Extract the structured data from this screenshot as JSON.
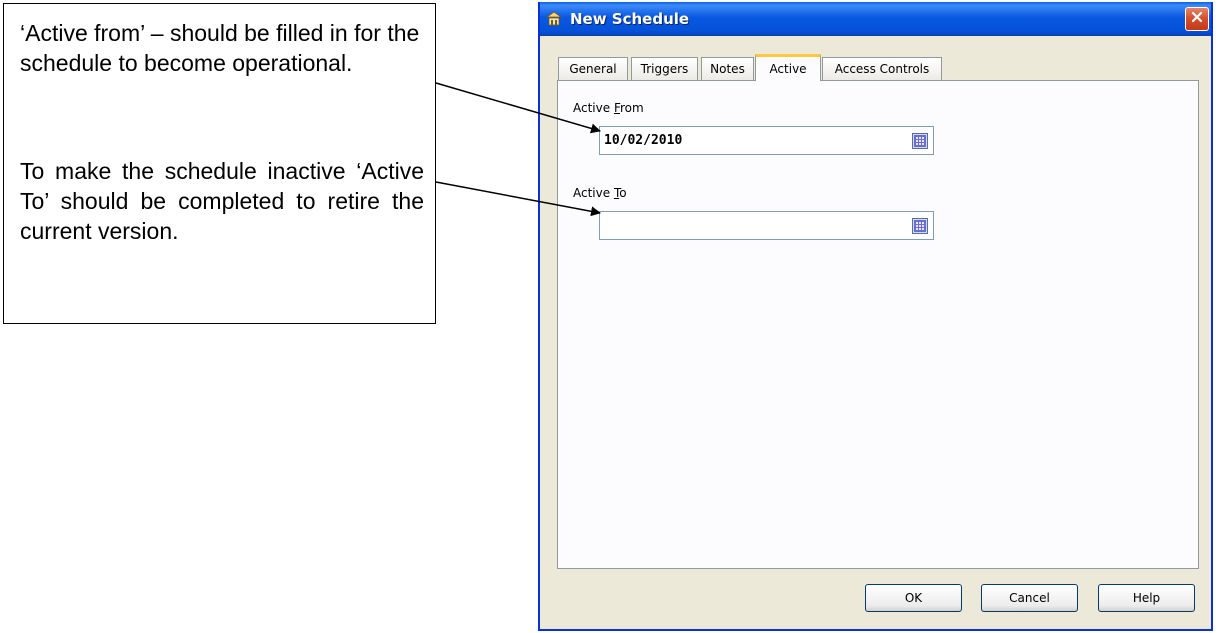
{
  "callout": {
    "paragraph1": "‘Active from’ – should be filled in for the schedule to become operational.",
    "paragraph2": "To make the schedule inactive ‘Active To’ should be completed to retire the current version."
  },
  "window": {
    "title": "New Schedule",
    "icons": {
      "app": "schedule-icon",
      "close": "close-icon"
    }
  },
  "tabs": [
    "General",
    "Triggers",
    "Notes",
    "Active",
    "Access Controls"
  ],
  "active_tab": "Active",
  "fields": {
    "active_from": {
      "label_prefix": "Active ",
      "label_mnemonic": "F",
      "label_suffix": "rom",
      "value": "10/02/2010",
      "icon": "calendar-icon"
    },
    "active_to": {
      "label_prefix": "Active ",
      "label_mnemonic": "T",
      "label_suffix": "o",
      "value": "",
      "icon": "calendar-icon"
    }
  },
  "buttons": {
    "ok": "OK",
    "cancel": "Cancel",
    "help": "Help"
  }
}
